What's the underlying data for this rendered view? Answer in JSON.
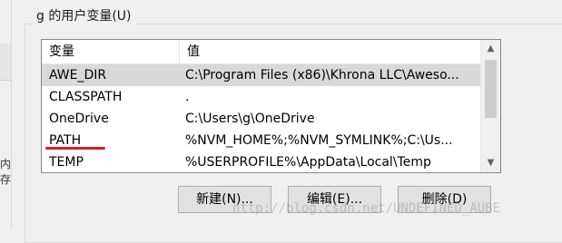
{
  "group": {
    "title": "g 的用户变量(U)"
  },
  "left_edge_text": "内存",
  "list": {
    "headers": [
      "变量",
      "值"
    ],
    "rows": [
      {
        "name": "AWE_DIR",
        "value": "C:\\Program Files (x86)\\Khrona LLC\\Aweso...",
        "selected": true
      },
      {
        "name": "CLASSPATH",
        "value": ".",
        "selected": false
      },
      {
        "name": "OneDrive",
        "value": "C:\\Users\\g\\OneDrive",
        "selected": false
      },
      {
        "name": "PATH",
        "value": "%NVM_HOME%;%NVM_SYMLINK%;C:\\Us...",
        "selected": false
      },
      {
        "name": "TEMP",
        "value": "%USERPROFILE%\\AppData\\Local\\Temp",
        "selected": false
      }
    ]
  },
  "buttons": {
    "new": "新建(N)...",
    "edit": "编辑(E)...",
    "delete": "删除(D)"
  },
  "watermark": "http://blog.csdn.net/UNDEFINED_AUBE",
  "colors": {
    "annotation_underline": "#d52020",
    "selected_row": "#d9d9d9"
  }
}
